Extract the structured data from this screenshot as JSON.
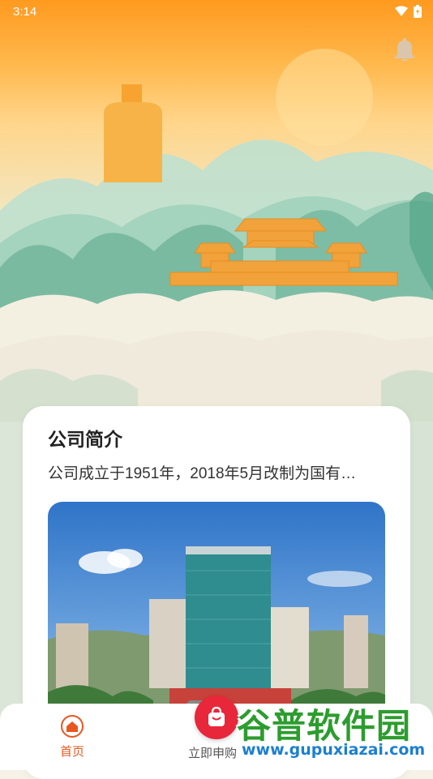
{
  "status_bar": {
    "time": "3:14"
  },
  "intro_card": {
    "title": "公司简介",
    "description": "公司成立于1951年，2018年5月改制为国有…"
  },
  "bottom_nav": {
    "home_label": "首页",
    "buy_label": "立即申购",
    "active_color": "#e8571f"
  },
  "watermark": {
    "text": "谷普软件园",
    "url": "www.gupuxiazai.com"
  },
  "colors": {
    "accent": "#e8571f",
    "fab": "#e8273a"
  }
}
